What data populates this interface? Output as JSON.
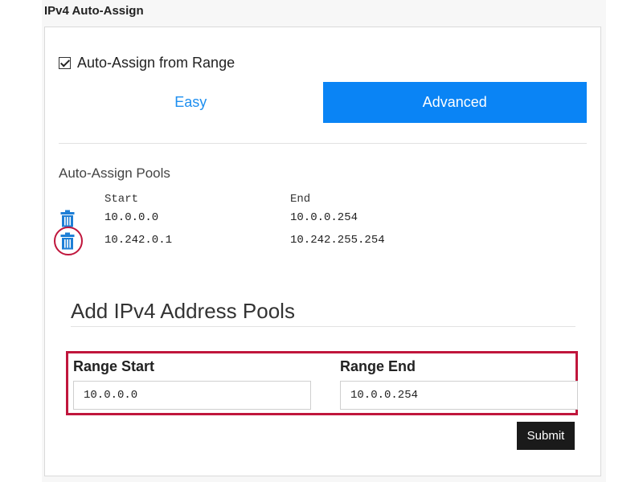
{
  "section": {
    "title": "IPv4 Auto-Assign"
  },
  "auto_assign": {
    "label": "Auto-Assign from Range",
    "checked": true
  },
  "mode_tabs": [
    {
      "label": "Easy",
      "active": false
    },
    {
      "label": "Advanced",
      "active": true
    }
  ],
  "pools": {
    "label": "Auto-Assign Pools",
    "columns": [
      "Start",
      "End"
    ],
    "rows": [
      {
        "start": "10.0.0.0",
        "end": "10.0.0.254",
        "icon": "trash-icon"
      },
      {
        "start": "10.242.0.1",
        "end": "10.242.255.254",
        "icon": "trash-icon"
      }
    ]
  },
  "add_pools": {
    "title": "Add IPv4 Address Pools",
    "range_start": {
      "label": "Range Start",
      "value": "10.0.0.0"
    },
    "range_end": {
      "label": "Range End",
      "value": "10.0.0.254"
    },
    "submit_label": "Submit"
  },
  "colors": {
    "accent": "#0a84f5",
    "highlight": "#c0163c",
    "icon": "#1e7fd6"
  }
}
